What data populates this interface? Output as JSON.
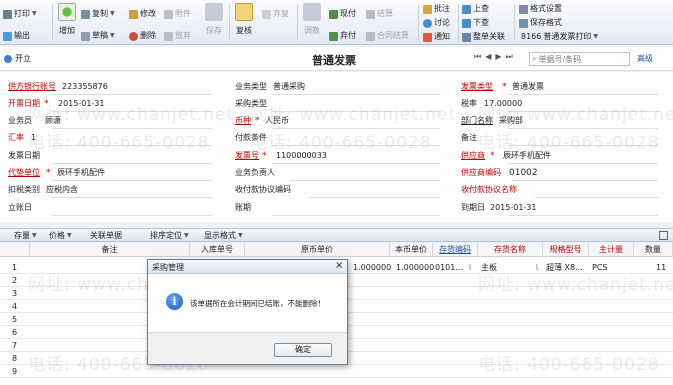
{
  "toolbar": {
    "print": "打印",
    "export": "输出",
    "add": "增加",
    "copy": "复制",
    "draft": "草稿",
    "modify": "修改",
    "delete": "删除",
    "attach": "附件",
    "abandon": "放弃",
    "save": "保存",
    "review": "复核",
    "redeposit": "弃复",
    "cashier": "现付",
    "settle": "结算",
    "discard_pay": "弃付",
    "contract_settle": "合同结算",
    "adjust": "调数",
    "approve": "批注",
    "discuss": "讨论",
    "notify": "通知",
    "previous": "上查",
    "next": "下查",
    "whole_link": "整单关联",
    "format_settings": "格式设置",
    "save_format": "保存格式",
    "template_code": "8166",
    "template_name": "普通发票打印"
  },
  "title_bar": {
    "open": "开立",
    "title": "普通发票",
    "search_placeholder": "单据号/条码",
    "advanced": "高级"
  },
  "form": {
    "supplier_bank_account_label": "供方银行账号",
    "supplier_bank_account": "223355876",
    "business_type_label": "业务类型",
    "business_type": "普通采购",
    "invoice_type_label": "发票类型",
    "invoice_type": "普通发票",
    "invoice_date_label": "开票日期",
    "invoice_date": "2015-01-31",
    "purchase_type_label": "采购类型",
    "purchase_type": "",
    "tax_rate_label": "税率",
    "tax_rate": "17.00000",
    "salesman_label": "业务员",
    "salesman": "顾潇",
    "currency_label": "币种",
    "currency": "人民币",
    "department_label": "部门名称",
    "department": "采购部",
    "exchange_rate_label": "汇率",
    "exchange_rate": "1",
    "payment_terms_label": "付款条件",
    "payment_terms": "",
    "remarks_label": "备注",
    "remarks": "",
    "invoice_date2_label": "发票日期",
    "invoice_date2": "",
    "invoice_no_label": "发票号",
    "invoice_no": "1100000033",
    "supplier_label": "供应商",
    "supplier": "辰环手机配件",
    "agent_label": "代垫单位",
    "agent": "辰环手机配件",
    "business_person_label": "业务负责人",
    "business_person": "",
    "supplier_code_label": "供应商编码",
    "supplier_code": "01002",
    "deduction_type_label": "扣税类别",
    "deduction_type": "应税内含",
    "agreement_code_label": "收付款协议编码",
    "agreement_code": "",
    "agreement_name_label": "收付款协议名称",
    "agreement_name": "",
    "account_date_label": "立账日",
    "account_date": "",
    "period_label": "账期",
    "period": "",
    "due_date_label": "到期日",
    "due_date": "2015-01-31"
  },
  "grid_toolbar": {
    "stock": "存量",
    "price": "价格",
    "link": "关联单据",
    "sort": "排序定位",
    "display": "显示格式"
  },
  "grid": {
    "headers": [
      "备注",
      "入库单号",
      "原币单价",
      "本币单价",
      "存货编码",
      "存货名称",
      "规格型号",
      "主计量",
      "数量"
    ],
    "rows": [
      {
        "no": "1",
        "remark": "",
        "receipt_no": "",
        "orig_price": "1.000000",
        "local_rate": "1.000000",
        "local_price": "0101...",
        "inv_code": "",
        "inv_name": "主板",
        "spec": "超薄 X8...",
        "unit": "PCS",
        "qty": "11"
      },
      {
        "no": "2"
      },
      {
        "no": "3"
      },
      {
        "no": "4"
      },
      {
        "no": "5"
      },
      {
        "no": "6"
      },
      {
        "no": "7"
      },
      {
        "no": "8"
      },
      {
        "no": "9"
      }
    ]
  },
  "watermark": {
    "phone": "电话: 400-665-0028",
    "site": "网址: www.chanjet.net"
  },
  "dialog": {
    "title": "采购管理",
    "message": "该单据所在会计期间已结账，不能删除！",
    "ok": "确定",
    "close": "×"
  },
  "colors": {
    "required": "#c00000",
    "blue_link": "#1f4fa0",
    "dialog_border": "#5e7fa8"
  }
}
